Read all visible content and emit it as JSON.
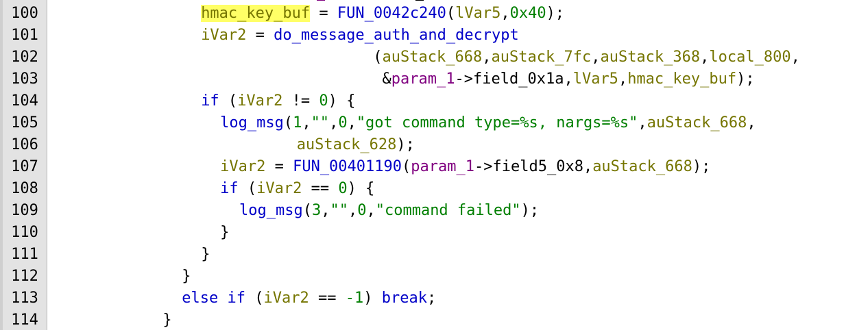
{
  "colors": {
    "keyword": "#0000c8",
    "function": "#0000c8",
    "local_var": "#757500",
    "param": "#800080",
    "literal": "#007f00",
    "highlight": "#ffff66",
    "gutter": "#e3e3e3"
  },
  "lines": [
    {
      "n": "100",
      "indent": 8,
      "tokens": [
        {
          "t": "hmac_key_buf",
          "c": "var hl"
        },
        {
          "t": " = ",
          "c": "plain"
        },
        {
          "t": "FUN_0042c240",
          "c": "fn"
        },
        {
          "t": "(",
          "c": "plain"
        },
        {
          "t": "lVar5",
          "c": "var"
        },
        {
          "t": ",",
          "c": "plain"
        },
        {
          "t": "0x40",
          "c": "num"
        },
        {
          "t": ");",
          "c": "plain"
        }
      ]
    },
    {
      "n": "101",
      "indent": 8,
      "tokens": [
        {
          "t": "iVar2",
          "c": "var"
        },
        {
          "t": " = ",
          "c": "plain"
        },
        {
          "t": "do_message_auth_and_decrypt",
          "c": "fn"
        }
      ]
    },
    {
      "n": "102",
      "indent": 17,
      "tokens": [
        {
          "t": "(",
          "c": "plain"
        },
        {
          "t": "auStack_668",
          "c": "var"
        },
        {
          "t": ",",
          "c": "plain"
        },
        {
          "t": "auStack_7fc",
          "c": "var"
        },
        {
          "t": ",",
          "c": "plain"
        },
        {
          "t": "auStack_368",
          "c": "var"
        },
        {
          "t": ",",
          "c": "plain"
        },
        {
          "t": "local_800",
          "c": "var"
        },
        {
          "t": ",",
          "c": "plain"
        }
      ]
    },
    {
      "n": "103",
      "indent": 17,
      "tokens": [
        {
          "t": " &",
          "c": "plain"
        },
        {
          "t": "param_1",
          "c": "param"
        },
        {
          "t": "->field_0x1a,",
          "c": "plain"
        },
        {
          "t": "lVar5",
          "c": "var"
        },
        {
          "t": ",",
          "c": "plain"
        },
        {
          "t": "hmac_key_buf",
          "c": "var"
        },
        {
          "t": ");",
          "c": "plain"
        }
      ]
    },
    {
      "n": "104",
      "indent": 8,
      "tokens": [
        {
          "t": "if",
          "c": "kw"
        },
        {
          "t": " (",
          "c": "plain"
        },
        {
          "t": "iVar2",
          "c": "var"
        },
        {
          "t": " != ",
          "c": "plain"
        },
        {
          "t": "0",
          "c": "num"
        },
        {
          "t": ") {",
          "c": "plain"
        }
      ]
    },
    {
      "n": "105",
      "indent": 9,
      "tokens": [
        {
          "t": "log_msg",
          "c": "fn"
        },
        {
          "t": "(",
          "c": "plain"
        },
        {
          "t": "1",
          "c": "num"
        },
        {
          "t": ",",
          "c": "plain"
        },
        {
          "t": "\"\"",
          "c": "str"
        },
        {
          "t": ",",
          "c": "plain"
        },
        {
          "t": "0",
          "c": "num"
        },
        {
          "t": ",",
          "c": "plain"
        },
        {
          "t": "\"got command type=%s, nargs=%s\"",
          "c": "str"
        },
        {
          "t": ",",
          "c": "plain"
        },
        {
          "t": "auStack_668",
          "c": "var"
        },
        {
          "t": ",",
          "c": "plain"
        }
      ]
    },
    {
      "n": "106",
      "indent": 13,
      "tokens": [
        {
          "t": "auStack_628",
          "c": "var"
        },
        {
          "t": ");",
          "c": "plain"
        }
      ]
    },
    {
      "n": "107",
      "indent": 9,
      "tokens": [
        {
          "t": "iVar2",
          "c": "var"
        },
        {
          "t": " = ",
          "c": "plain"
        },
        {
          "t": "FUN_00401190",
          "c": "fn"
        },
        {
          "t": "(",
          "c": "plain"
        },
        {
          "t": "param_1",
          "c": "param"
        },
        {
          "t": "->field5_0x8,",
          "c": "plain"
        },
        {
          "t": "auStack_668",
          "c": "var"
        },
        {
          "t": ");",
          "c": "plain"
        }
      ]
    },
    {
      "n": "108",
      "indent": 9,
      "tokens": [
        {
          "t": "if",
          "c": "kw"
        },
        {
          "t": " (",
          "c": "plain"
        },
        {
          "t": "iVar2",
          "c": "var"
        },
        {
          "t": " == ",
          "c": "plain"
        },
        {
          "t": "0",
          "c": "num"
        },
        {
          "t": ") {",
          "c": "plain"
        }
      ]
    },
    {
      "n": "109",
      "indent": 10,
      "tokens": [
        {
          "t": "log_msg",
          "c": "fn"
        },
        {
          "t": "(",
          "c": "plain"
        },
        {
          "t": "3",
          "c": "num"
        },
        {
          "t": ",",
          "c": "plain"
        },
        {
          "t": "\"\"",
          "c": "str"
        },
        {
          "t": ",",
          "c": "plain"
        },
        {
          "t": "0",
          "c": "num"
        },
        {
          "t": ",",
          "c": "plain"
        },
        {
          "t": "\"command failed\"",
          "c": "str"
        },
        {
          "t": ");",
          "c": "plain"
        }
      ]
    },
    {
      "n": "110",
      "indent": 9,
      "tokens": [
        {
          "t": "}",
          "c": "plain"
        }
      ]
    },
    {
      "n": "111",
      "indent": 8,
      "tokens": [
        {
          "t": "}",
          "c": "plain"
        }
      ]
    },
    {
      "n": "112",
      "indent": 7,
      "tokens": [
        {
          "t": "}",
          "c": "plain"
        }
      ]
    },
    {
      "n": "113",
      "indent": 7,
      "tokens": [
        {
          "t": "else",
          "c": "kw"
        },
        {
          "t": " ",
          "c": "plain"
        },
        {
          "t": "if",
          "c": "kw"
        },
        {
          "t": " (",
          "c": "plain"
        },
        {
          "t": "iVar2",
          "c": "var"
        },
        {
          "t": " == ",
          "c": "plain"
        },
        {
          "t": "-1",
          "c": "num"
        },
        {
          "t": ") ",
          "c": "plain"
        },
        {
          "t": "break",
          "c": "kw"
        },
        {
          "t": ";",
          "c": "plain"
        }
      ]
    },
    {
      "n": "114",
      "indent": 6,
      "tokens": [
        {
          "t": "}",
          "c": "plain"
        }
      ]
    }
  ]
}
